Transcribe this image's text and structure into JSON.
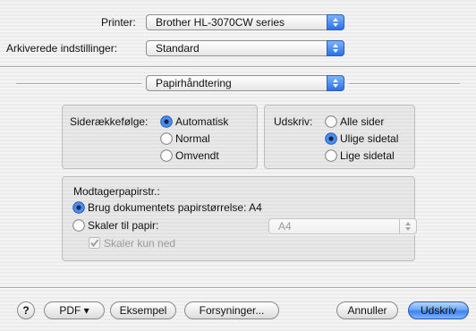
{
  "printer": {
    "label": "Printer:",
    "value": "Brother HL-3070CW series"
  },
  "presets": {
    "label": "Arkiverede indstillinger:",
    "value": "Standard"
  },
  "panel": {
    "value": "Papirhåndtering"
  },
  "page_order": {
    "label": "Siderækkefølge:",
    "options": [
      {
        "label": "Automatisk",
        "selected": true
      },
      {
        "label": "Normal",
        "selected": false
      },
      {
        "label": "Omvendt",
        "selected": false
      }
    ]
  },
  "print_pages": {
    "label": "Udskriv:",
    "options": [
      {
        "label": "Alle sider",
        "selected": false
      },
      {
        "label": "Ulige sidetal",
        "selected": true
      },
      {
        "label": "Lige sidetal",
        "selected": false
      }
    ]
  },
  "destination": {
    "title": "Modtagerpapirstr.:",
    "use_document": {
      "label": "Brug dokumentets papirstørrelse: A4",
      "selected": true
    },
    "scale": {
      "label": "Skaler til papir:",
      "selected": false,
      "popup_value": "A4"
    },
    "scale_down": {
      "label": "Skaler kun ned",
      "checked": true
    }
  },
  "buttons": {
    "help": "?",
    "pdf": "PDF ▾",
    "preview": "Eksempel",
    "supplies": "Forsyninger...",
    "cancel": "Annuller",
    "print": "Udskriv"
  },
  "colors": {
    "accent": "#3f82ee",
    "group_border": "#bdbdbd"
  },
  "icons": {
    "popup_arrows": "up-down-arrows-icon",
    "radio": "radio-icon",
    "checkbox": "check-icon"
  }
}
